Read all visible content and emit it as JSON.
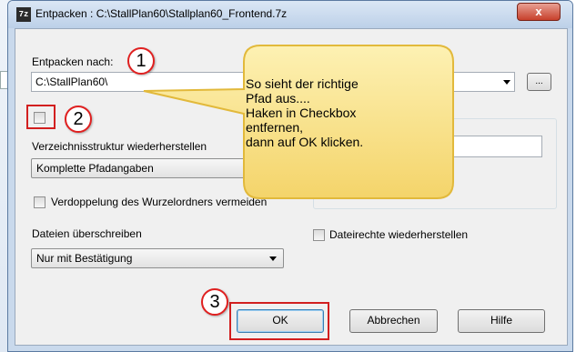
{
  "window": {
    "app_icon_text": "7z",
    "title": "Entpacken : C:\\StallPlan60\\Stallplan60_Frontend.7z",
    "close_label": "x"
  },
  "extract_to": {
    "label": "Entpacken nach:",
    "value": "C:\\StallPlan60\\",
    "browse_label": "..."
  },
  "path_mode": {
    "label": "Verzeichnisstruktur wiederherstellen",
    "selected": "Komplette Pfadangaben"
  },
  "eliminate_duplicate": {
    "label": "Verdoppelung des Wurzelordners vermeiden"
  },
  "overwrite": {
    "label": "Dateien überschreiben",
    "selected": "Nur mit Bestätigung"
  },
  "restore_rights": {
    "label": "Dateirechte wiederherstellen"
  },
  "buttons": {
    "ok": "OK",
    "cancel": "Abbrechen",
    "help": "Hilfe"
  },
  "annotations": {
    "marker1": "1",
    "marker2": "2",
    "marker3": "3",
    "callout": "So sieht der richtige\nPfad aus....\nHaken in Checkbox\nentfernen,\ndann auf OK klicken."
  },
  "colors": {
    "callout_fill": "#fbe48a",
    "highlight": "#d21f1f"
  }
}
